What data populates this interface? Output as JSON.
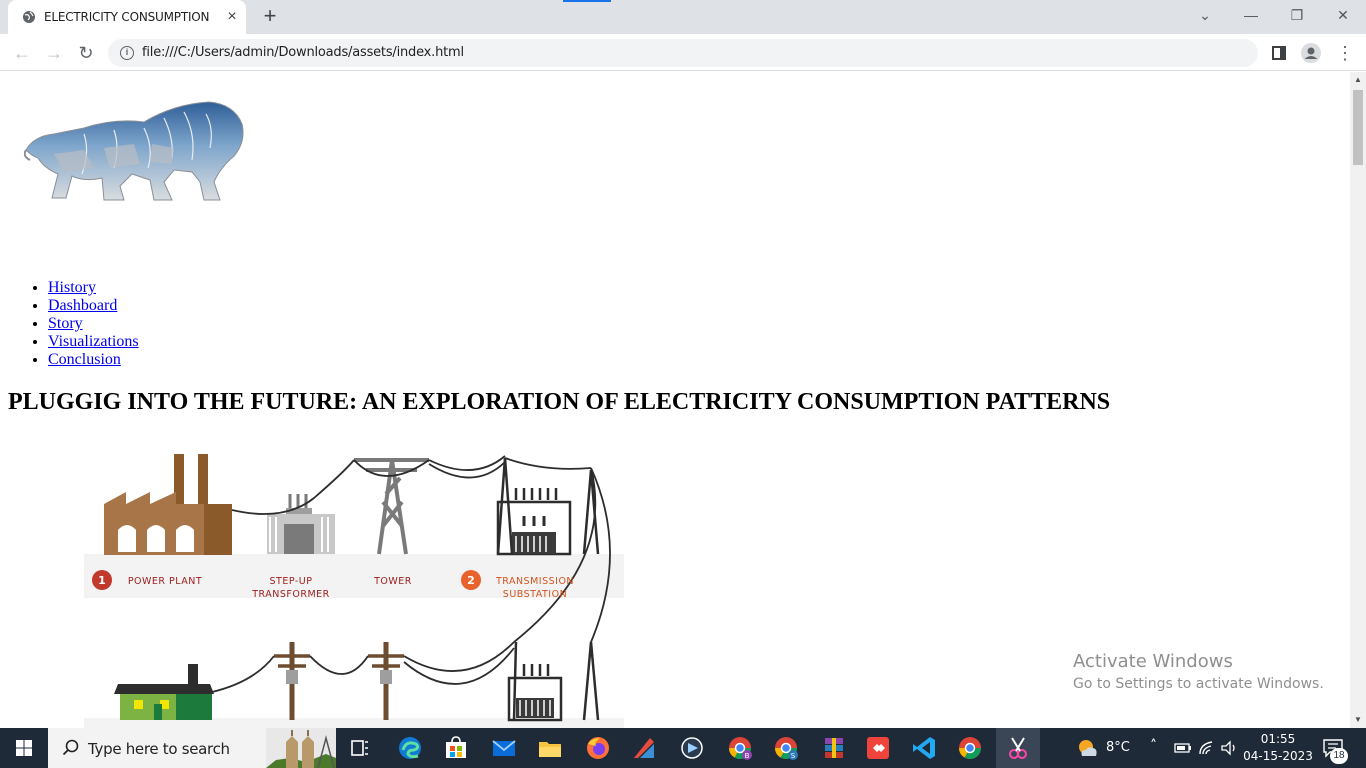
{
  "browser": {
    "tab_title": "ELECTRICITY CONSUMPTION",
    "new_tab_symbol": "+",
    "url": "file:///C:/Users/admin/Downloads/assets/index.html"
  },
  "page": {
    "nav": [
      "History",
      "Dashboard",
      "Story",
      "Visualizations",
      "Conclusion"
    ],
    "headline": "PLUGGIG INTO THE FUTURE: AN EXPLORATION OF ELECTRICITY CONSUMPTION PATTERNS",
    "diagram_labels": {
      "step1_num": "1",
      "power_plant": "POWER PLANT",
      "step_up_1": "STEP-UP",
      "step_up_2": "TRANSFORMER",
      "tower": "TOWER",
      "step2_num": "2",
      "transmission_1": "TRANSMISSION",
      "transmission_2": "SUBSTATION"
    }
  },
  "watermark": {
    "line1": "Activate Windows",
    "line2": "Go to Settings to activate Windows."
  },
  "taskbar": {
    "search_placeholder": "Type here to search",
    "weather_temp": "8°C",
    "time": "01:55",
    "date": "04-15-2023",
    "notifications_count": "18"
  },
  "colors": {
    "link": "#0000ee",
    "taskbar": "#1f2a38",
    "brand_red": "#c0392b",
    "brand_orange": "#e8632b"
  }
}
